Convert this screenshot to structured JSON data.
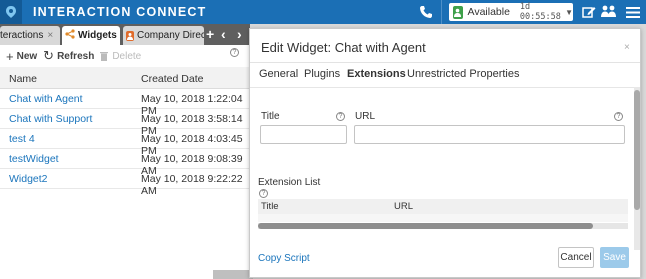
{
  "header": {
    "app_title": "INTERACTION CONNECT",
    "status_label": "Available",
    "status_time": "1d 00:55:58",
    "icons": [
      "logo-icon",
      "phone-icon",
      "status-icon",
      "compose-icon",
      "people-icon",
      "menu-icon"
    ],
    "colors": {
      "bar": "#1b6fb5",
      "status": "#3ea04a"
    }
  },
  "left_panel": {
    "tabs": [
      {
        "label": "teractions",
        "close": "×"
      },
      {
        "label": "Widgets",
        "close": "×"
      },
      {
        "label": "Company Directo"
      }
    ],
    "tab_nav": {
      "add": "+",
      "prev": "‹",
      "next": "›"
    },
    "toolbar": {
      "new_label": "New",
      "refresh_label": "Refresh",
      "delete_label": "Delete"
    },
    "help_glyph": "?",
    "columns": {
      "name": "Name",
      "date": "Created Date"
    },
    "rows": [
      {
        "name": "Chat with Agent",
        "date": "May 10, 2018 1:22:04 PM"
      },
      {
        "name": "Chat with Support",
        "date": "May 10, 2018 3:58:14 PM"
      },
      {
        "name": "test 4",
        "date": "May 10, 2018 4:03:45 PM"
      },
      {
        "name": "testWidget",
        "date": "May 10, 2018 9:08:39 AM"
      },
      {
        "name": "Widget2",
        "date": "May 10, 2018 9:22:22 AM"
      }
    ]
  },
  "modal": {
    "title": "Edit Widget: Chat with Agent",
    "close": "×",
    "tabs": [
      "General",
      "Plugins",
      "Extensions",
      "Unrestricted Properties"
    ],
    "active_tab": "Extensions",
    "title_label": "Title",
    "url_label": "URL",
    "title_value": "",
    "url_value": "",
    "extension_list_label": "Extension List",
    "extension_columns": {
      "title": "Title",
      "url": "URL"
    },
    "copy_script": "Copy Script",
    "cancel": "Cancel",
    "save": "Save"
  }
}
